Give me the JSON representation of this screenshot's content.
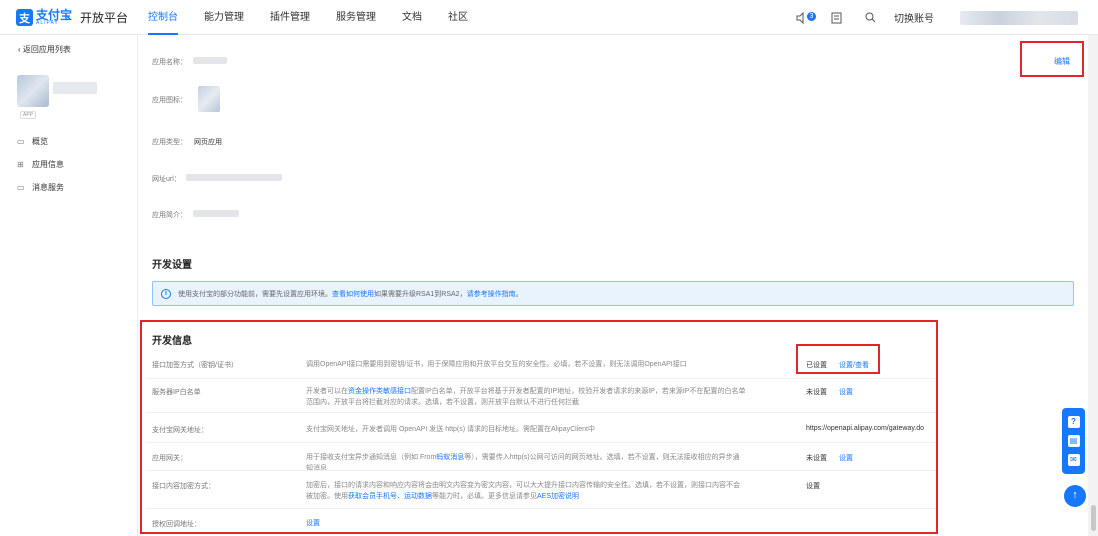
{
  "header": {
    "logo_mark": "支",
    "logo_cn": "支付宝",
    "logo_en": "ALIPAY",
    "platform": "开放平台",
    "nav": [
      {
        "label": "控制台",
        "active": true
      },
      {
        "label": "能力管理",
        "active": false
      },
      {
        "label": "插件管理",
        "active": false
      },
      {
        "label": "服务管理",
        "active": false
      },
      {
        "label": "文档",
        "active": false
      },
      {
        "label": "社区",
        "active": false
      }
    ],
    "notify_badge": "3",
    "switch_account": "切换账号",
    "icons": [
      "speaker-icon",
      "document-icon",
      "search-icon"
    ]
  },
  "sidebar": {
    "back": "返回应用列表",
    "app_tag": "APP",
    "items": [
      {
        "label": "概览",
        "icon": "monitor-icon"
      },
      {
        "label": "应用信息",
        "icon": "grid-icon"
      },
      {
        "label": "消息服务",
        "icon": "message-icon"
      }
    ]
  },
  "app_info": {
    "edit": "编辑",
    "fields": [
      {
        "label": "应用名称："
      },
      {
        "label": "应用图标："
      },
      {
        "label": "应用类型：",
        "value": "网页应用"
      },
      {
        "label": "网址url："
      },
      {
        "label": "应用简介："
      }
    ]
  },
  "dev_settings": {
    "title": "开发设置",
    "notice_text_1": "使用支付宝的部分功能前，需要先设置应用环境。",
    "notice_link_1": "查看如何使用",
    "notice_text_2": "如果需要升级RSA1到RSA2，",
    "notice_link_2": "请参考操作指南",
    "notice_end": "。"
  },
  "dev_info": {
    "title": "开发信息",
    "rows": [
      {
        "label": "接口加签方式（密钥/证书）",
        "desc": "调用OpenAPI接口需要用到密钥/证书，用于保障应用和开放平台交互的安全性。必填，若不设置，则无法调用OpenAPI接口",
        "status": "已设置",
        "action": "设置/查看"
      },
      {
        "label": "服务器IP白名单",
        "desc_1": "开发者可以在",
        "desc_link": "资金操作类敏感接口",
        "desc_2": "配置IP白名单，开放平台将基于开发者配置的IP地址，校验开发者请求的来源IP，若来源IP不在配置的白名单范围内，开放平台将拦截对应的请求。选填，若不设置，则开放平台默认不进行任何拦截",
        "status": "未设置",
        "action": "设置"
      },
      {
        "label": "支付宝网关地址：",
        "desc": "支付宝网关地址，开发者调用 OpenAPI 发送 http(s) 请求的目标地址。需配置在AlipayClient中",
        "status": "https://openapi.alipay.com/gateway.do"
      },
      {
        "label": "应用网关：",
        "desc_1": "用于接收支付宝异步通知消息（例如 From",
        "desc_link": "蚂蚁消息",
        "desc_2": "等），需要传入http(s)公网可访问的网页地址。选填，若不设置，则无法接收相应的异步通知消息",
        "status": "未设置",
        "action": "设置"
      },
      {
        "label": "接口内容加密方式：",
        "desc_1": "加密后，接口的请求内容和响应内容将会由明文内容变为密文内容，可以大大提升接口内容传输的安全性。选填，若不设置，则接口内容不会被加密。使用",
        "desc_link": "获取会员手机号、运动数据",
        "desc_2": "等能力时，必填。更多信息请参见",
        "desc_link_2": "AES加密说明",
        "status_link": "设置"
      },
      {
        "label": "授权回调地址：",
        "desc_link": "设置"
      }
    ]
  },
  "floating": {
    "icons": [
      "question-icon",
      "chat-icon",
      "feedback-icon"
    ],
    "back_to_top": "↑"
  }
}
